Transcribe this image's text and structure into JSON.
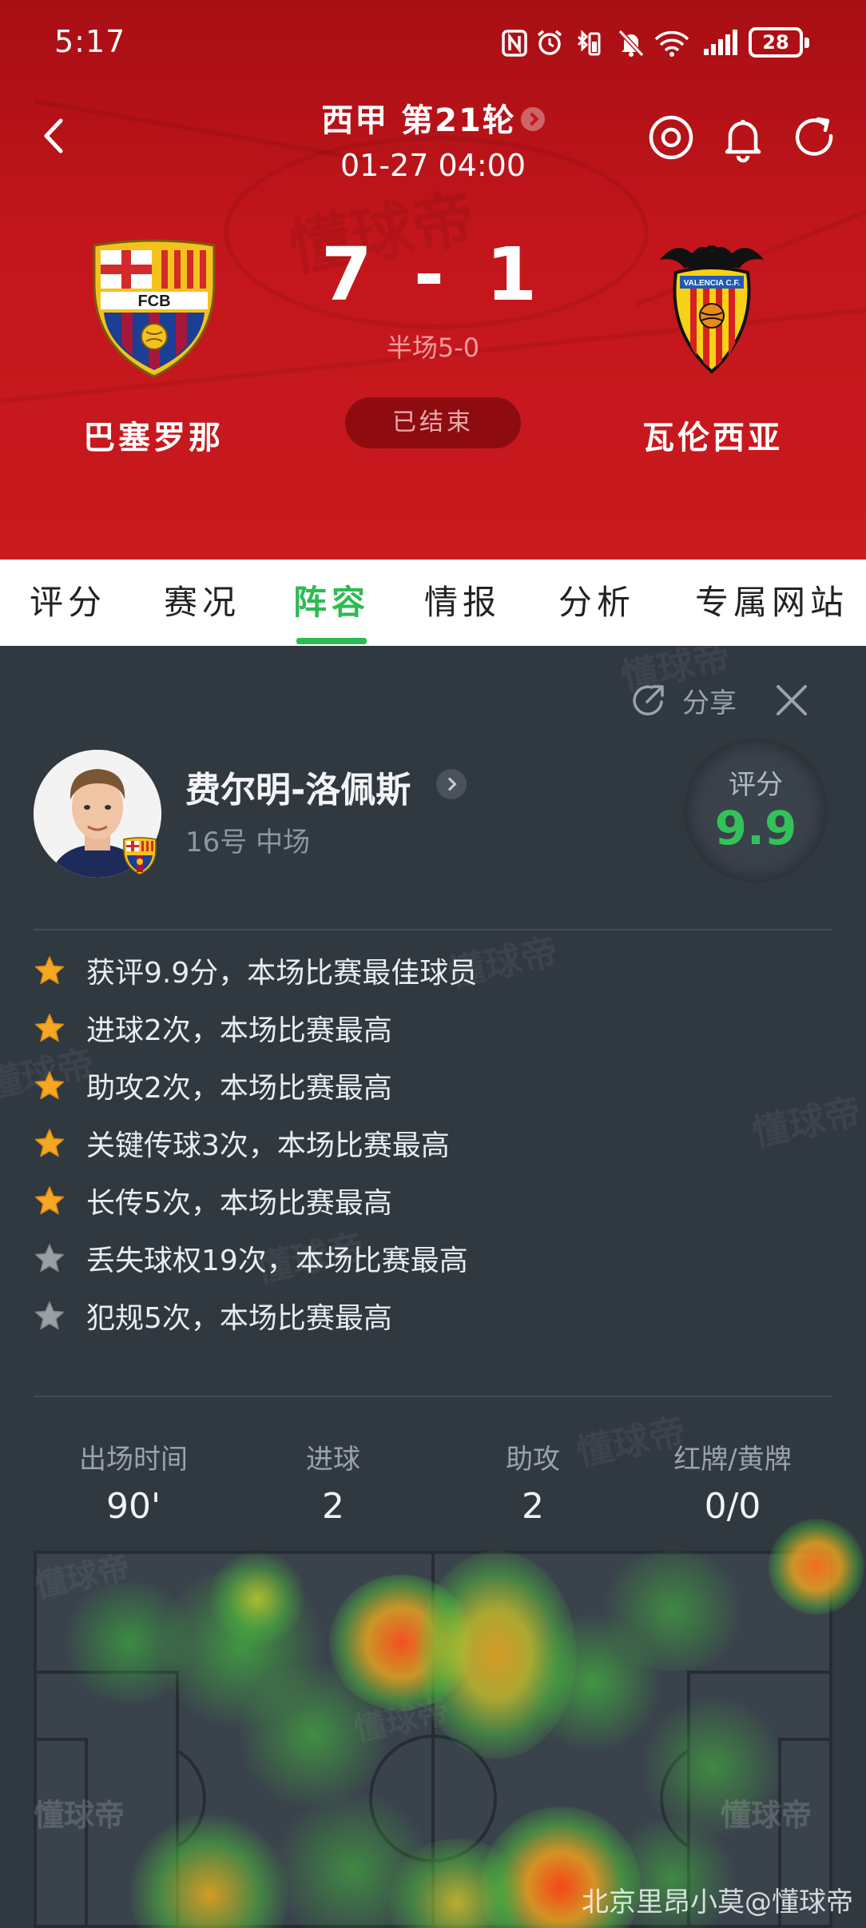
{
  "status_bar": {
    "time": "5:17",
    "battery": "28"
  },
  "header": {
    "league": "西甲 第21轮",
    "match_time": "01-27 04:00",
    "home_team": "巴塞罗那",
    "away_team": "瓦伦西亚",
    "score": "7 - 1",
    "halftime": "半场5-0",
    "status": "已结束",
    "home_logo_text": "FCB",
    "away_logo_text": "VALENCIA C.F."
  },
  "tabs": [
    {
      "label": "评分"
    },
    {
      "label": "赛况"
    },
    {
      "label": "阵容",
      "active": true
    },
    {
      "label": "情报"
    },
    {
      "label": "分析"
    },
    {
      "label": "专属网站"
    }
  ],
  "panel": {
    "share_label": "分享",
    "watermark": "懂球帝",
    "player": {
      "name": "费尔明-洛佩斯",
      "subtitle": "16号 中场"
    },
    "rating": {
      "label": "评分",
      "value": "9.9"
    },
    "highlights": [
      {
        "text": "获评9.9分，本场比赛最佳球员",
        "star": "gold"
      },
      {
        "text": "进球2次，本场比赛最高",
        "star": "gold"
      },
      {
        "text": "助攻2次，本场比赛最高",
        "star": "gold"
      },
      {
        "text": "关键传球3次，本场比赛最高",
        "star": "gold"
      },
      {
        "text": "长传5次，本场比赛最高",
        "star": "gold"
      },
      {
        "text": "丢失球权19次，本场比赛最高",
        "star": "gray"
      },
      {
        "text": "犯规5次，本场比赛最高",
        "star": "gray"
      }
    ],
    "stats": [
      {
        "label": "出场时间",
        "value": "90'"
      },
      {
        "label": "进球",
        "value": "2"
      },
      {
        "label": "助攻",
        "value": "2"
      },
      {
        "label": "红牌/黄牌",
        "value": "0/0"
      }
    ],
    "credit": "北京里昂小莫@懂球帝"
  },
  "colors": {
    "header_red": "#c3161c",
    "accent_green": "#2dbb54",
    "rating_green": "#33c25a",
    "panel_bg": "#303840",
    "star_gold": "#f5a623",
    "star_gray": "#9aa0a6"
  }
}
